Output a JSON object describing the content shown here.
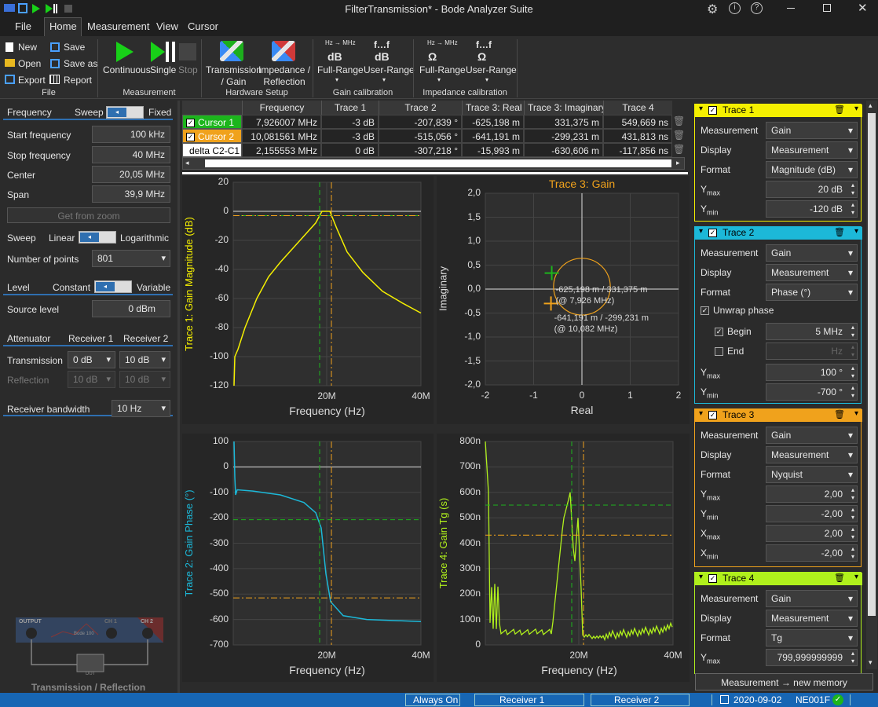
{
  "window": {
    "title": "FilterTransmission* - Bode Analyzer Suite"
  },
  "menu": {
    "file": "File",
    "home": "Home",
    "measurement": "Measurement",
    "view": "View",
    "cursor": "Cursor"
  },
  "ribbon": {
    "new": "New",
    "open": "Open",
    "export": "Export",
    "save": "Save",
    "save_as": "Save as",
    "report": "Report",
    "group_file": "File",
    "continuous": "Continuous",
    "single": "Single",
    "stop": "Stop",
    "group_measurement": "Measurement",
    "transmission": "Transmission\n/ Gain",
    "impedance": "Impedance /\nReflection",
    "group_hardware": "Hardware Setup",
    "hz_mhz": "Hz → MHz",
    "f_dots": "f…f",
    "gain_full": "Full-Range",
    "gain_user": "User-Range",
    "gain_unit": "dB",
    "group_gain": "Gain calibration",
    "imp_full": "Full-Range",
    "imp_user": "User-Range",
    "imp_unit": "Ω",
    "group_imp": "Impedance calibration"
  },
  "left": {
    "frequency": "Frequency",
    "sweep": "Sweep",
    "fixed": "Fixed",
    "start_label": "Start frequency",
    "start_value": "100 kHz",
    "stop_label": "Stop frequency",
    "stop_value": "40 MHz",
    "center_label": "Center",
    "center_value": "20,05 MHz",
    "span_label": "Span",
    "span_value": "39,9 MHz",
    "get_zoom": "Get from zoom",
    "sweep_label": "Sweep",
    "linear": "Linear",
    "log": "Logarithmic",
    "points_label": "Number of points",
    "points_value": "801",
    "level": "Level",
    "constant": "Constant",
    "variable": "Variable",
    "source_label": "Source level",
    "source_value": "0 dBm",
    "attenuator": "Attenuator",
    "receiver1": "Receiver 1",
    "receiver2": "Receiver 2",
    "transmission": "Transmission",
    "tr_r1": "0 dB",
    "tr_r2": "10 dB",
    "reflection": "Reflection",
    "rf_r1": "10 dB",
    "rf_r2": "10 dB",
    "bw_label": "Receiver bandwidth",
    "bw_value": "10 Hz",
    "diagram_caption": "Transmission / Reflection",
    "diagram_output": "OUTPUT",
    "diagram_ch1": "CH 1",
    "diagram_ch2": "CH 2",
    "diagram_bode": "Bode 100",
    "diagram_dut": "DUT"
  },
  "cursor_table": {
    "headers": [
      "Frequency",
      "Trace 1",
      "Trace 2",
      "Trace 3: Real",
      "Trace 3: Imaginary",
      "Trace 4"
    ],
    "rows": [
      {
        "name": "Cursor 1",
        "color": "#1cb51c",
        "cells": [
          "7,926007 MHz",
          "-3 dB",
          "-207,839 °",
          "-625,198 m",
          "331,375 m",
          "549,669 ns"
        ]
      },
      {
        "name": "Cursor 2",
        "color": "#f0a21c",
        "cells": [
          "10,081561 MHz",
          "-3 dB",
          "-515,056 °",
          "-641,191 m",
          "-299,231 m",
          "431,813 ns"
        ]
      },
      {
        "name": "delta C2-C1",
        "color": "#ffffff",
        "cells": [
          "2,155553 MHz",
          "0 dB",
          "-307,218 °",
          "-15,993 m",
          "-630,606 m",
          "-117,856 ns"
        ]
      }
    ]
  },
  "plots": {
    "p1": {
      "ylabel": "Trace 1: Gain Magnitude (dB)",
      "xlabel": "Frequency (Hz)",
      "yticks": [
        "20",
        "0",
        "-20",
        "-40",
        "-60",
        "-80",
        "-100",
        "-120"
      ],
      "xticks": [
        "20M",
        "40M"
      ]
    },
    "p2": {
      "ylabel": "Trace 2: Gain Phase (°)",
      "xlabel": "Frequency (Hz)",
      "yticks": [
        "100",
        "0",
        "-100",
        "-200",
        "-300",
        "-400",
        "-500",
        "-600",
        "-700"
      ],
      "xticks": [
        "20M",
        "40M"
      ]
    },
    "p3": {
      "title": "Trace 3: Gain",
      "ylabel": "Imaginary",
      "xlabel": "Real",
      "yticks": [
        "2,0",
        "1,5",
        "1,0",
        "0,5",
        "0,0",
        "-0,5",
        "-1,0",
        "-1,5",
        "-2,0"
      ],
      "xticks": [
        "-2",
        "-1",
        "0",
        "1",
        "2"
      ],
      "ann1": "-625,198 m / 331,375 m",
      "ann1b": "(@ 7,926 MHz)",
      "ann2": "-641,191 m / -299,231 m",
      "ann2b": "(@ 10,082 MHz)"
    },
    "p4": {
      "ylabel": "Trace 4: Gain Tg (s)",
      "xlabel": "Frequency (Hz)",
      "yticks": [
        "800n",
        "700n",
        "600n",
        "500n",
        "400n",
        "300n",
        "200n",
        "100n",
        "0"
      ],
      "xticks": [
        "20M",
        "40M"
      ]
    }
  },
  "traces": [
    {
      "title": "Trace 1",
      "color": "#f5f000",
      "rows": [
        [
          "Measurement",
          "Gain",
          "dd"
        ],
        [
          "Display",
          "Measurement",
          "dd"
        ],
        [
          "Format",
          "Magnitude (dB)",
          "dd"
        ],
        [
          "Ymax",
          "20 dB",
          "tb"
        ],
        [
          "Ymin",
          "-120 dB",
          "tb"
        ]
      ]
    },
    {
      "title": "Trace 2",
      "color": "#1cb8d8",
      "rows": [
        [
          "Measurement",
          "Gain",
          "dd"
        ],
        [
          "Display",
          "Measurement",
          "dd"
        ],
        [
          "Format",
          "Phase (°)",
          "dd"
        ]
      ],
      "unwrap": "Unwrap phase",
      "begin": "Begin",
      "begin_value": "5 MHz",
      "end": "End",
      "end_value": "Hz",
      "ymax": "100 °",
      "ymin": "-700 °",
      "ymax_label": "Ymax",
      "ymin_label": "Ymin"
    },
    {
      "title": "Trace 3",
      "color": "#f0a21c",
      "rows": [
        [
          "Measurement",
          "Gain",
          "dd"
        ],
        [
          "Display",
          "Measurement",
          "dd"
        ],
        [
          "Format",
          "Nyquist",
          "dd"
        ],
        [
          "Ymax",
          "2,00",
          "tb"
        ],
        [
          "Ymin",
          "-2,00",
          "tb"
        ],
        [
          "Xmax",
          "2,00",
          "tb"
        ],
        [
          "Xmin",
          "-2,00",
          "tb"
        ]
      ]
    },
    {
      "title": "Trace 4",
      "color": "#b0f01c",
      "rows": [
        [
          "Measurement",
          "Gain",
          "dd"
        ],
        [
          "Display",
          "Measurement",
          "dd"
        ],
        [
          "Format",
          "Tg",
          "dd"
        ],
        [
          "Ymax",
          "799,999999999",
          "tb"
        ]
      ]
    }
  ],
  "memory_button": "Measurement → new memory",
  "status": {
    "always_on": "Always On",
    "receiver1": "Receiver 1",
    "receiver2": "Receiver 2",
    "date": "2020-09-02",
    "device": "NE001F"
  }
}
